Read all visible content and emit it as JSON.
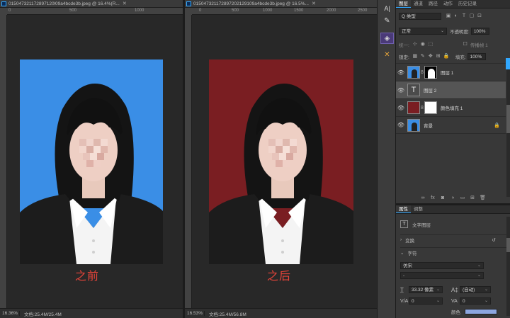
{
  "left_document": {
    "tab_title": "015047321172897120l09a4bcde3b.jpeg @ 16.4%(R...",
    "ruler_ticks": [
      "0",
      "500",
      "1000"
    ],
    "caption": "之前",
    "background_color": "#3a8ee6",
    "zoom": "16.36%",
    "doc_info": "文档:25.4M/25.4M"
  },
  "right_document": {
    "tab_title": "015047321172897202129109a4bcde3b.jpeg @ 16.5%...",
    "ruler_ticks": [
      "0",
      "500",
      "1000",
      "1500",
      "2000",
      "2500"
    ],
    "caption": "之后",
    "background_color": "#7a1e22",
    "zoom": "16.53%",
    "doc_info": "文档:25.4M/56.8M"
  },
  "toolstrip": {
    "items": [
      "text-tool",
      "brush-tool",
      "cube-tool",
      "crossed-tool"
    ]
  },
  "layers_panel": {
    "tabs": [
      "图层",
      "通道",
      "路径",
      "动作",
      "历史记录"
    ],
    "active_tab": "图层",
    "filter_placeholder": "Q 类型",
    "blend_mode": "正常",
    "opacity_label": "不透明度:",
    "opacity_value": "100%",
    "lock_label": "锁定:",
    "fill_label": "填充:",
    "fill_value": "100%",
    "unify_label": "统一:",
    "propagate_label": "传播帧 1",
    "layers": [
      {
        "name": "图层 1",
        "type": "image-mask"
      },
      {
        "name": "图层 2",
        "type": "text",
        "selected": true
      },
      {
        "name": "颜色填充 1",
        "type": "fill"
      },
      {
        "name": "背景",
        "type": "background",
        "locked": true
      }
    ],
    "bottom_icons": [
      "link-icon",
      "fx-icon",
      "mask-icon",
      "adjustment-icon",
      "folder-icon",
      "new-layer-icon",
      "trash-icon"
    ]
  },
  "properties_panel": {
    "tabs": [
      "属性",
      "调整"
    ],
    "active_tab": "属性",
    "layer_kind": "文字图层",
    "section_transform": "变换",
    "section_character": "字符",
    "font_family": "仿宋",
    "font_style": "-",
    "font_size": "33.32 像素",
    "leading": "(自动)",
    "tracking": "0",
    "kerning": "0",
    "color_label": "颜色",
    "color_value": "#8da6e0"
  }
}
